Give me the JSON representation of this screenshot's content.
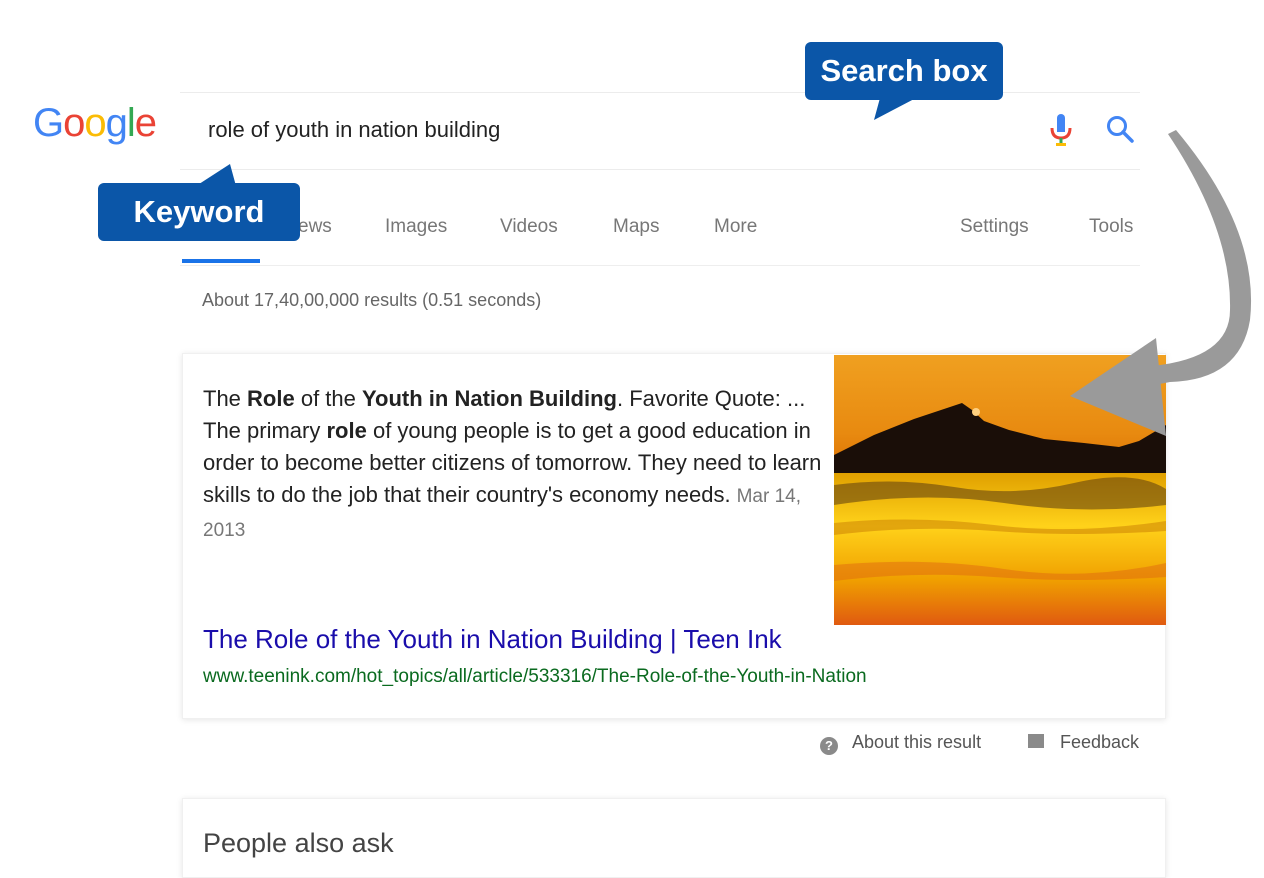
{
  "logo": {
    "letters": [
      "G",
      "o",
      "o",
      "g",
      "l",
      "e"
    ],
    "colors": [
      "#4285F4",
      "#EA4335",
      "#FBBC05",
      "#4285F4",
      "#34A853",
      "#EA4335"
    ]
  },
  "search": {
    "query": "role of youth in nation building",
    "mic_icon": "mic-icon",
    "search_icon": "search-icon"
  },
  "tabs": {
    "items": [
      {
        "label": "ews"
      },
      {
        "label": "Images"
      },
      {
        "label": "Videos"
      },
      {
        "label": "Maps"
      },
      {
        "label": "More"
      }
    ],
    "settings": "Settings",
    "tools": "Tools",
    "active_color": "#1a73e8"
  },
  "stats": "About 17,40,00,000 results (0.51 seconds)",
  "featured": {
    "snippet_parts": [
      {
        "text": "The ",
        "bold": false
      },
      {
        "text": "Role",
        "bold": true
      },
      {
        "text": " of the ",
        "bold": false
      },
      {
        "text": "Youth in Nation Building",
        "bold": true
      },
      {
        "text": ". Favorite Quote: ... The primary ",
        "bold": false
      },
      {
        "text": "role",
        "bold": true
      },
      {
        "text": " of young people is to get a good education in order to become better citizens of tomorrow. They need to learn skills to do the job that their country's economy needs.",
        "bold": false
      }
    ],
    "date": "Mar 14, 2013",
    "title": "The Role of the Youth in Nation Building | Teen Ink",
    "url": "www.teenink.com/hot_topics/all/article/533316/The-Role-of-the-Youth-in-Nation",
    "title_color": "#1a0dab",
    "url_color": "#0a6a1f"
  },
  "footer_links": {
    "about": "About this result",
    "feedback": "Feedback"
  },
  "people_also_ask": "People also ask",
  "callouts": {
    "search_box": "Search box",
    "keyword": "Keyword",
    "color": "#0b56a8"
  }
}
